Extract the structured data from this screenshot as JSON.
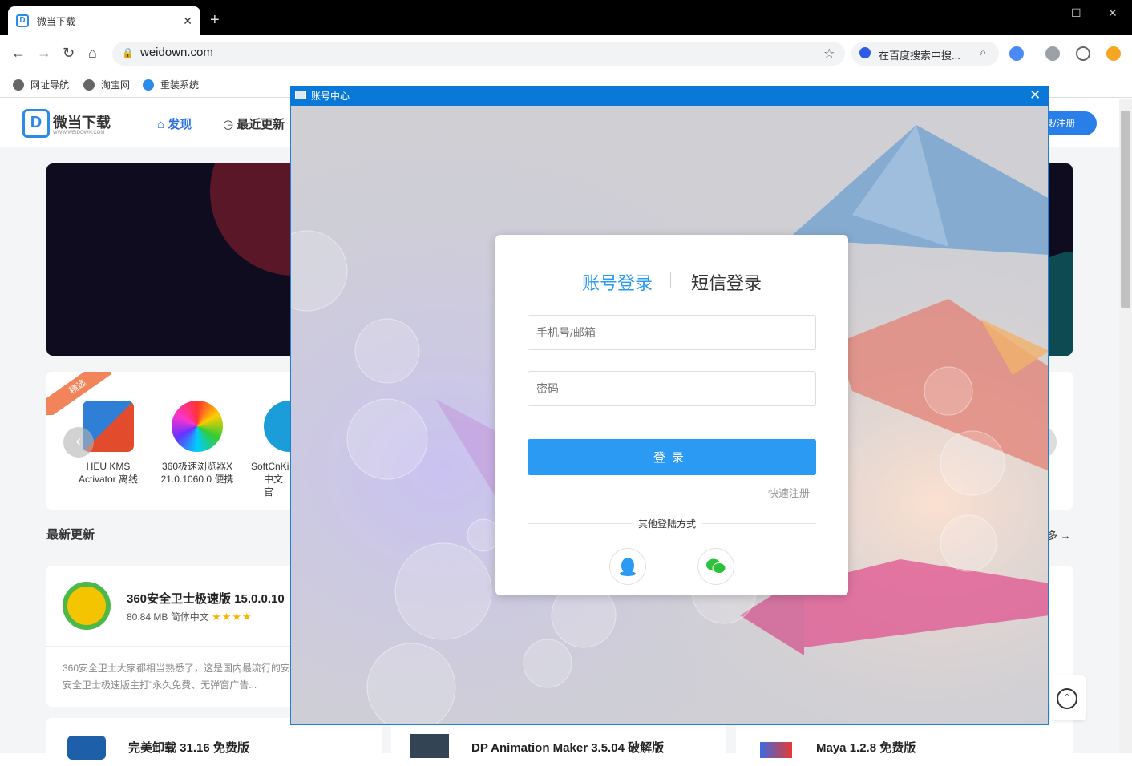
{
  "browser": {
    "tab_title": "微当下载",
    "tab_favicon": "D",
    "new_tab": "+",
    "url": "weidown.com",
    "search_box": "在百度搜索中搜...",
    "bookmarks": [
      "网址导航",
      "淘宝网",
      "重装系统"
    ],
    "window_controls": {
      "minimize": "—",
      "maximize": "☐",
      "close": "✕"
    }
  },
  "site": {
    "logo_letter": "D",
    "logo_text": "微当下载",
    "logo_sub": "WWW.WEIDOWN.COM",
    "nav_find": "发现",
    "nav_recent": "最近更新",
    "register_label": "录/注册",
    "picks_ribbon": "精选",
    "picks": [
      {
        "line1": "HEU KMS",
        "line2": "Activator 离线"
      },
      {
        "line1": "360极速浏览器X",
        "line2": "21.0.1060.0 便携"
      },
      {
        "line1": "SoftCnKi",
        "line2": "中文官"
      }
    ],
    "latest_title": "最新更新",
    "more_label": "多 →",
    "cards": [
      {
        "title": "360安全卫士极速版 15.0.0.10",
        "meta": "80.84 MB  简体中文",
        "stars": "★★★★",
        "desc1": "360安全卫士大家都相当熟悉了，这是国内最流行的安",
        "desc2": "安全卫士极速版主打\"永久免费、无弹窗广告..."
      },
      {
        "title": "完美卸载 31.16 免费版"
      },
      {
        "title": "DP Animation Maker 3.5.04 破解版"
      },
      {
        "title": "Maya 1.2.8 免费版"
      }
    ]
  },
  "dialog": {
    "title": "账号中心",
    "close": "✕",
    "tab_account": "账号登录",
    "tab_sms": "短信登录",
    "phone_placeholder": "手机号/邮箱",
    "password_placeholder": "密码",
    "login_button": "登录",
    "quick_register": "快速注册",
    "other_methods": "其他登陆方式"
  },
  "colors": {
    "accent": "#2b9af3",
    "titlebar": "#0a78d7",
    "brand": "#2a8be8"
  }
}
